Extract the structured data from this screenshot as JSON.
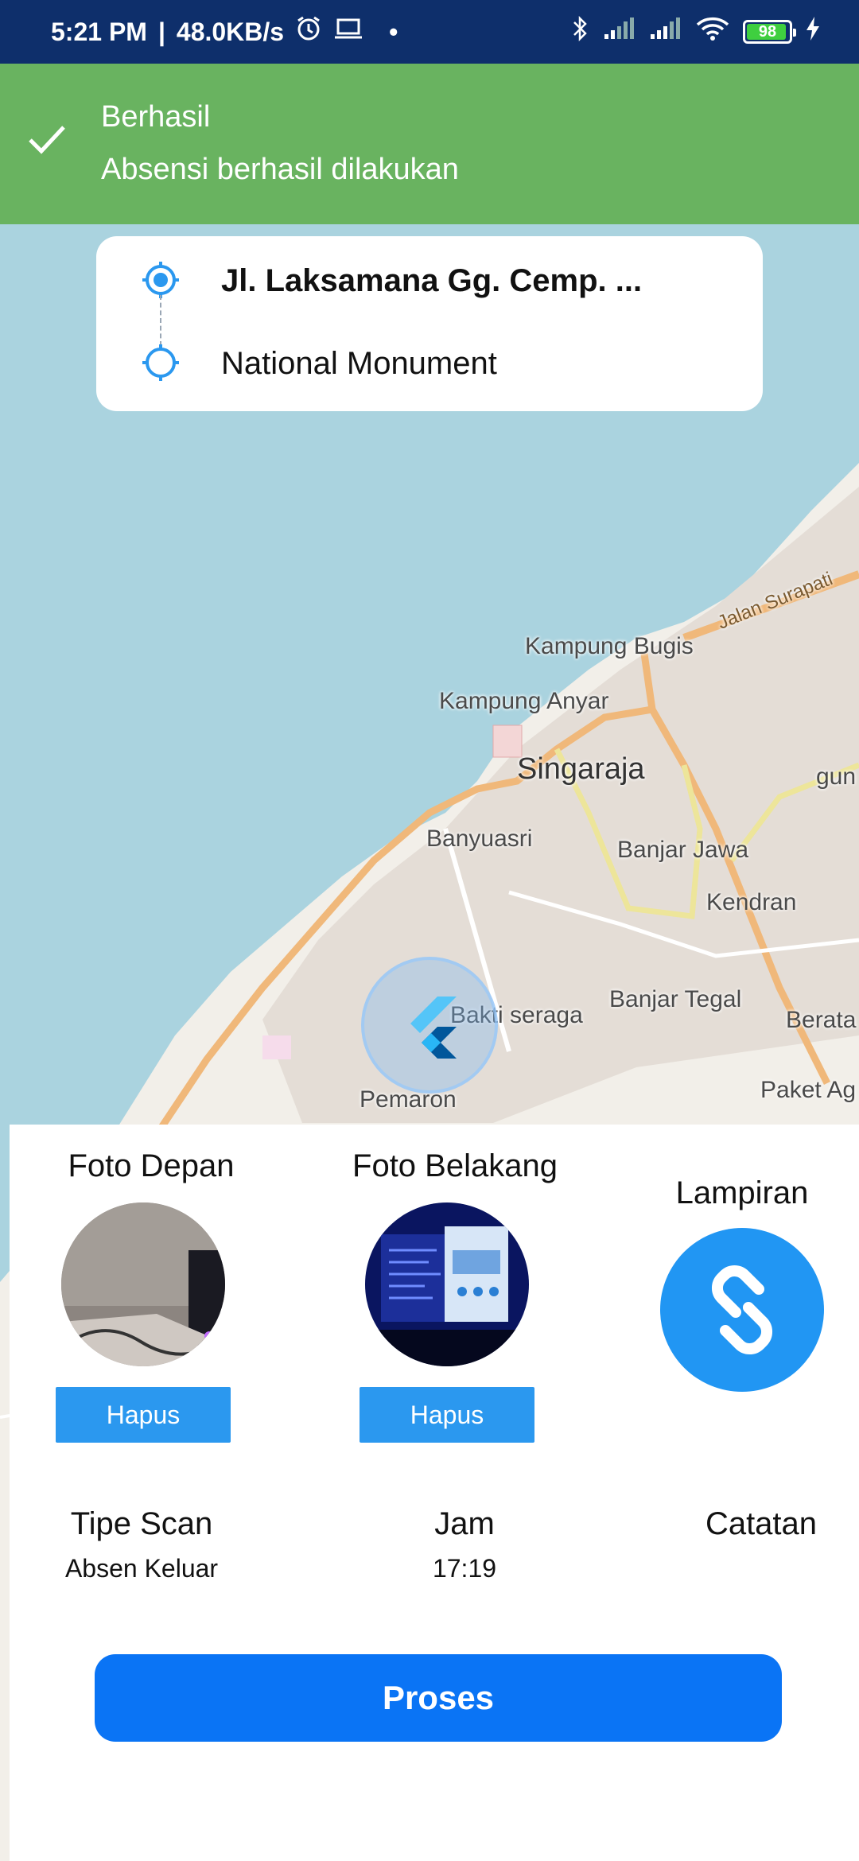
{
  "status_bar": {
    "time": "5:21 PM",
    "network_speed": "48.0KB/s",
    "battery_level": "98",
    "icons": [
      "alarm-icon",
      "laptop-icon",
      "bluetooth-icon",
      "signal-icon",
      "signal-icon",
      "wifi-icon",
      "battery-icon",
      "charging-icon"
    ]
  },
  "toast": {
    "title": "Berhasil",
    "message": "Absensi berhasil dilakukan",
    "icon": "check-icon",
    "color": "#69b360"
  },
  "route": {
    "origin": "Jl. Laksamana Gg. Cemp. ...",
    "destination": "National Monument"
  },
  "map_labels": [
    "Jalan Surapati",
    "Kampung Bugis",
    "Kampung Anyar",
    "Singaraja",
    "gun",
    "Banyuasri",
    "Banjar Jawa",
    "Kendran",
    "Bakti seraga",
    "Banjar Tegal",
    "Berata",
    "Paket Ag",
    "Pemaron"
  ],
  "photos": {
    "front_title": "Foto Depan",
    "back_title": "Foto Belakang",
    "attachment_title": "Lampiran",
    "delete_label": "Hapus"
  },
  "info": {
    "scan_type_label": "Tipe Scan",
    "scan_type_value": "Absen Keluar",
    "time_label": "Jam",
    "time_value": "17:19",
    "note_label": "Catatan"
  },
  "submit_label": "Proses",
  "colors": {
    "status_bar": "#0e2f6b",
    "accent": "#2196f3",
    "button": "#0a74f5",
    "sea": "#aad3df",
    "land": "#f2efe9"
  }
}
